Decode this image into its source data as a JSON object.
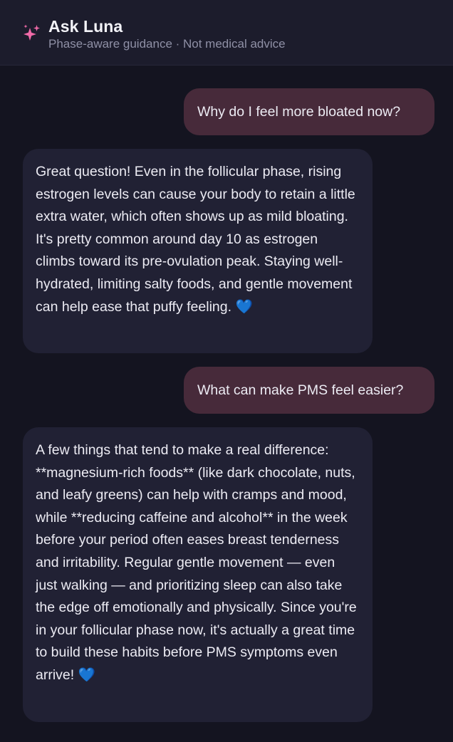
{
  "header": {
    "title": "Ask Luna",
    "subtitle": "Phase-aware guidance · Not medical advice",
    "icon": "sparkles-icon"
  },
  "messages": [
    {
      "role": "user",
      "text": "Why do I feel more bloated now?"
    },
    {
      "role": "assistant",
      "text": "Great question! Even in the follicular phase, rising estrogen levels can cause your body to retain a little extra water, which often shows up as mild bloating. It's pretty common around day 10 as estrogen climbs toward its pre-ovulation peak. Staying well-hydrated, limiting salty foods, and gentle movement can help ease that puffy feeling.",
      "emoji": "💙"
    },
    {
      "role": "user",
      "text": "What can make PMS feel easier?"
    },
    {
      "role": "assistant",
      "text": "A few things that tend to make a real difference: **magnesium-rich foods** (like dark chocolate, nuts, and leafy greens) can help with cramps and mood, while **reducing caffeine and alcohol** in the week before your period often eases breast tenderness and irritability. Regular gentle movement — even just walking — and prioritizing sleep can also take the edge off emotionally and physically. Since you're in your follicular phase now, it's actually a great time to build these habits before PMS symptoms even arrive!",
      "emoji": "💙"
    }
  ],
  "colors": {
    "background": "#141420",
    "header": "#1c1c2c",
    "user_bubble": "#472a3a",
    "assistant_bubble": "#212134",
    "accent": "#f06aa8",
    "heart": "#2f86f0"
  }
}
